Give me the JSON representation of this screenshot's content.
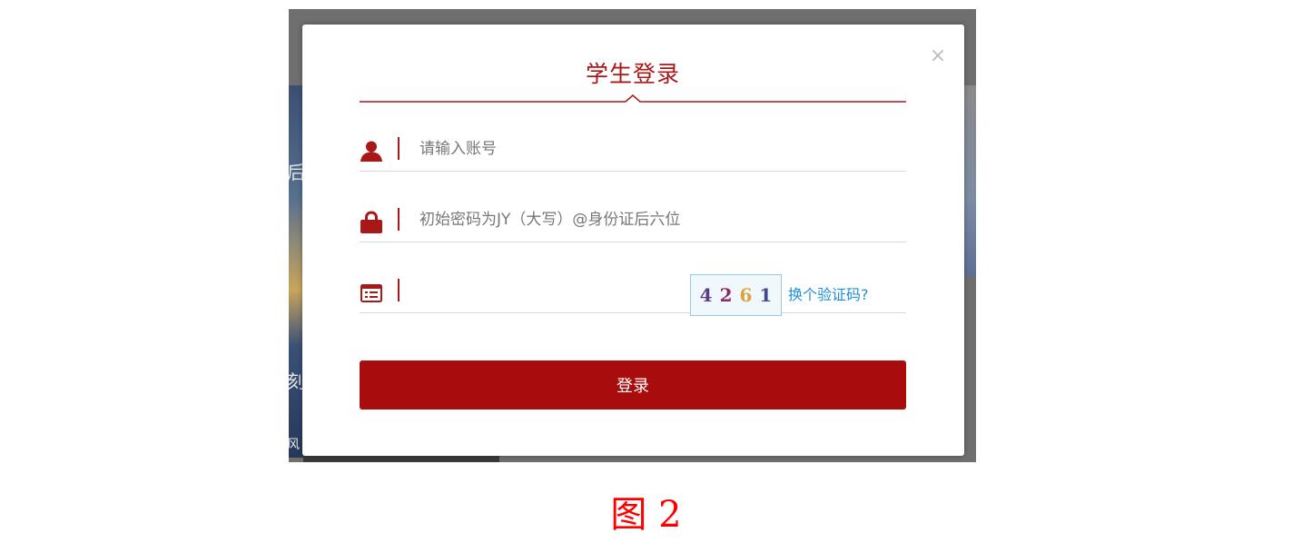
{
  "dialog": {
    "title": "学生登录",
    "close_label": "×"
  },
  "account": {
    "icon": "user-icon",
    "placeholder": "请输入账号",
    "value": ""
  },
  "password": {
    "icon": "lock-icon",
    "placeholder": "初始密码为JY（大写）@身份证后六位",
    "value": ""
  },
  "captcha": {
    "icon": "form-list-icon",
    "value": "",
    "digits": [
      {
        "char": "4",
        "color": "#5a3b8c"
      },
      {
        "char": "2",
        "color": "#8a2a6a"
      },
      {
        "char": "6",
        "color": "#d9a43a"
      },
      {
        "char": "1",
        "color": "#3f4a8a"
      }
    ],
    "refresh_label": "换个验证码?"
  },
  "login_button": {
    "label": "登录"
  },
  "caption": "图 2",
  "colors": {
    "accent": "#a81818",
    "button": "#a80c0c",
    "link": "#1f8ed8",
    "caption": "#ff0000"
  }
}
